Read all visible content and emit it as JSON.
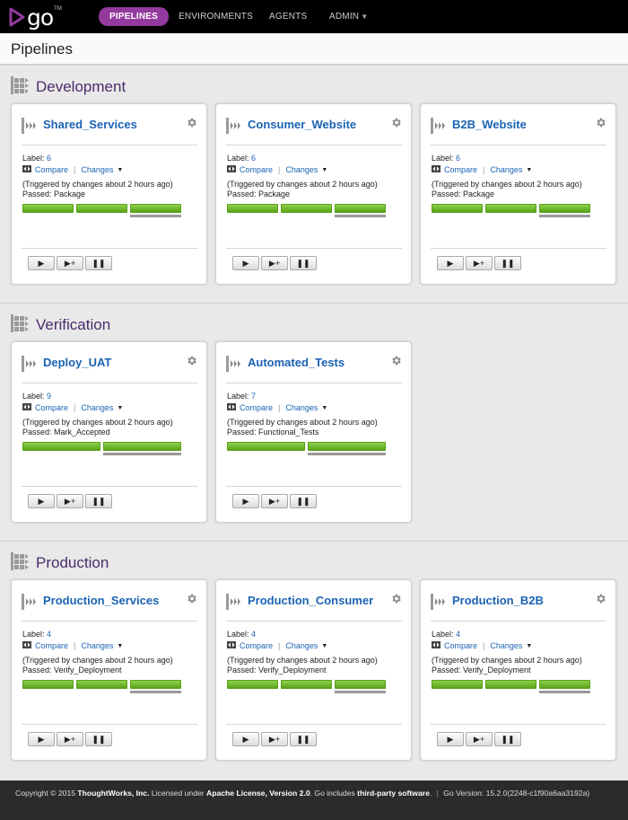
{
  "nav": {
    "logo_text": "go",
    "logo_tm": "TM",
    "items": [
      {
        "label": "PIPELINES",
        "active": true
      },
      {
        "label": "ENVIRONMENTS",
        "active": false
      },
      {
        "label": "AGENTS",
        "active": false
      },
      {
        "label": "ADMIN",
        "active": false,
        "has_caret": true
      }
    ],
    "caret": "▼"
  },
  "page": {
    "title": "Pipelines"
  },
  "colors": {
    "accent": "#943a9e",
    "link": "#1b63b4",
    "group_title": "#4a2b6b",
    "stage_passed": "#6cb62a"
  },
  "groups": [
    {
      "name": "Development",
      "pipelines": [
        {
          "name": "Shared_Services",
          "label_prefix": "Label:",
          "label": "6",
          "compare": "Compare",
          "changes": "Changes",
          "trigger": "(Triggered by changes about 2 hours ago)",
          "passed": "Passed: Package"
        },
        {
          "name": "Consumer_Website",
          "label_prefix": "Label:",
          "label": "6",
          "compare": "Compare",
          "changes": "Changes",
          "trigger": "(Triggered by changes about 2 hours ago)",
          "passed": "Passed: Package"
        },
        {
          "name": "B2B_Website",
          "label_prefix": "Label:",
          "label": "6",
          "compare": "Compare",
          "changes": "Changes",
          "trigger": "(Triggered by changes about 2 hours ago)",
          "passed": "Passed: Package"
        }
      ]
    },
    {
      "name": "Verification",
      "pipelines": [
        {
          "name": "Deploy_UAT",
          "label_prefix": "Label:",
          "label": "9",
          "compare": "Compare",
          "changes": "Changes",
          "trigger": "(Triggered by changes about 2 hours ago)",
          "passed": "Passed: Mark_Accepted"
        },
        {
          "name": "Automated_Tests",
          "label_prefix": "Label:",
          "label": "7",
          "compare": "Compare",
          "changes": "Changes",
          "trigger": "(Triggered by changes about 2 hours ago)",
          "passed": "Passed: Functional_Tests"
        }
      ]
    },
    {
      "name": "Production",
      "pipelines": [
        {
          "name": "Production_Services",
          "label_prefix": "Label:",
          "label": "4",
          "compare": "Compare",
          "changes": "Changes",
          "trigger": "(Triggered by changes about 2 hours ago)",
          "passed": "Passed: Verify_Deployment"
        },
        {
          "name": "Production_Consumer",
          "label_prefix": "Label:",
          "label": "4",
          "compare": "Compare",
          "changes": "Changes",
          "trigger": "(Triggered by changes about 2 hours ago)",
          "passed": "Passed: Verify_Deployment"
        },
        {
          "name": "Production_B2B",
          "label_prefix": "Label:",
          "label": "4",
          "compare": "Compare",
          "changes": "Changes",
          "trigger": "(Triggered by changes about 2 hours ago)",
          "passed": "Passed: Verify_Deployment"
        }
      ]
    }
  ],
  "icons": {
    "gear": "gear-icon",
    "play": "▶",
    "play_with_options": "▶+",
    "pause": "❚❚"
  },
  "footer": {
    "copyright": "Copyright © 2015",
    "company": "ThoughtWorks, Inc.",
    "licensed": "Licensed under",
    "license": "Apache License, Version 2.0",
    "includes": ". Go includes",
    "thirdparty": "third-party software",
    "period": ".",
    "separator": "|",
    "version": "Go Version: 15.2.0(2248-c1f90a6aa3192a)"
  }
}
